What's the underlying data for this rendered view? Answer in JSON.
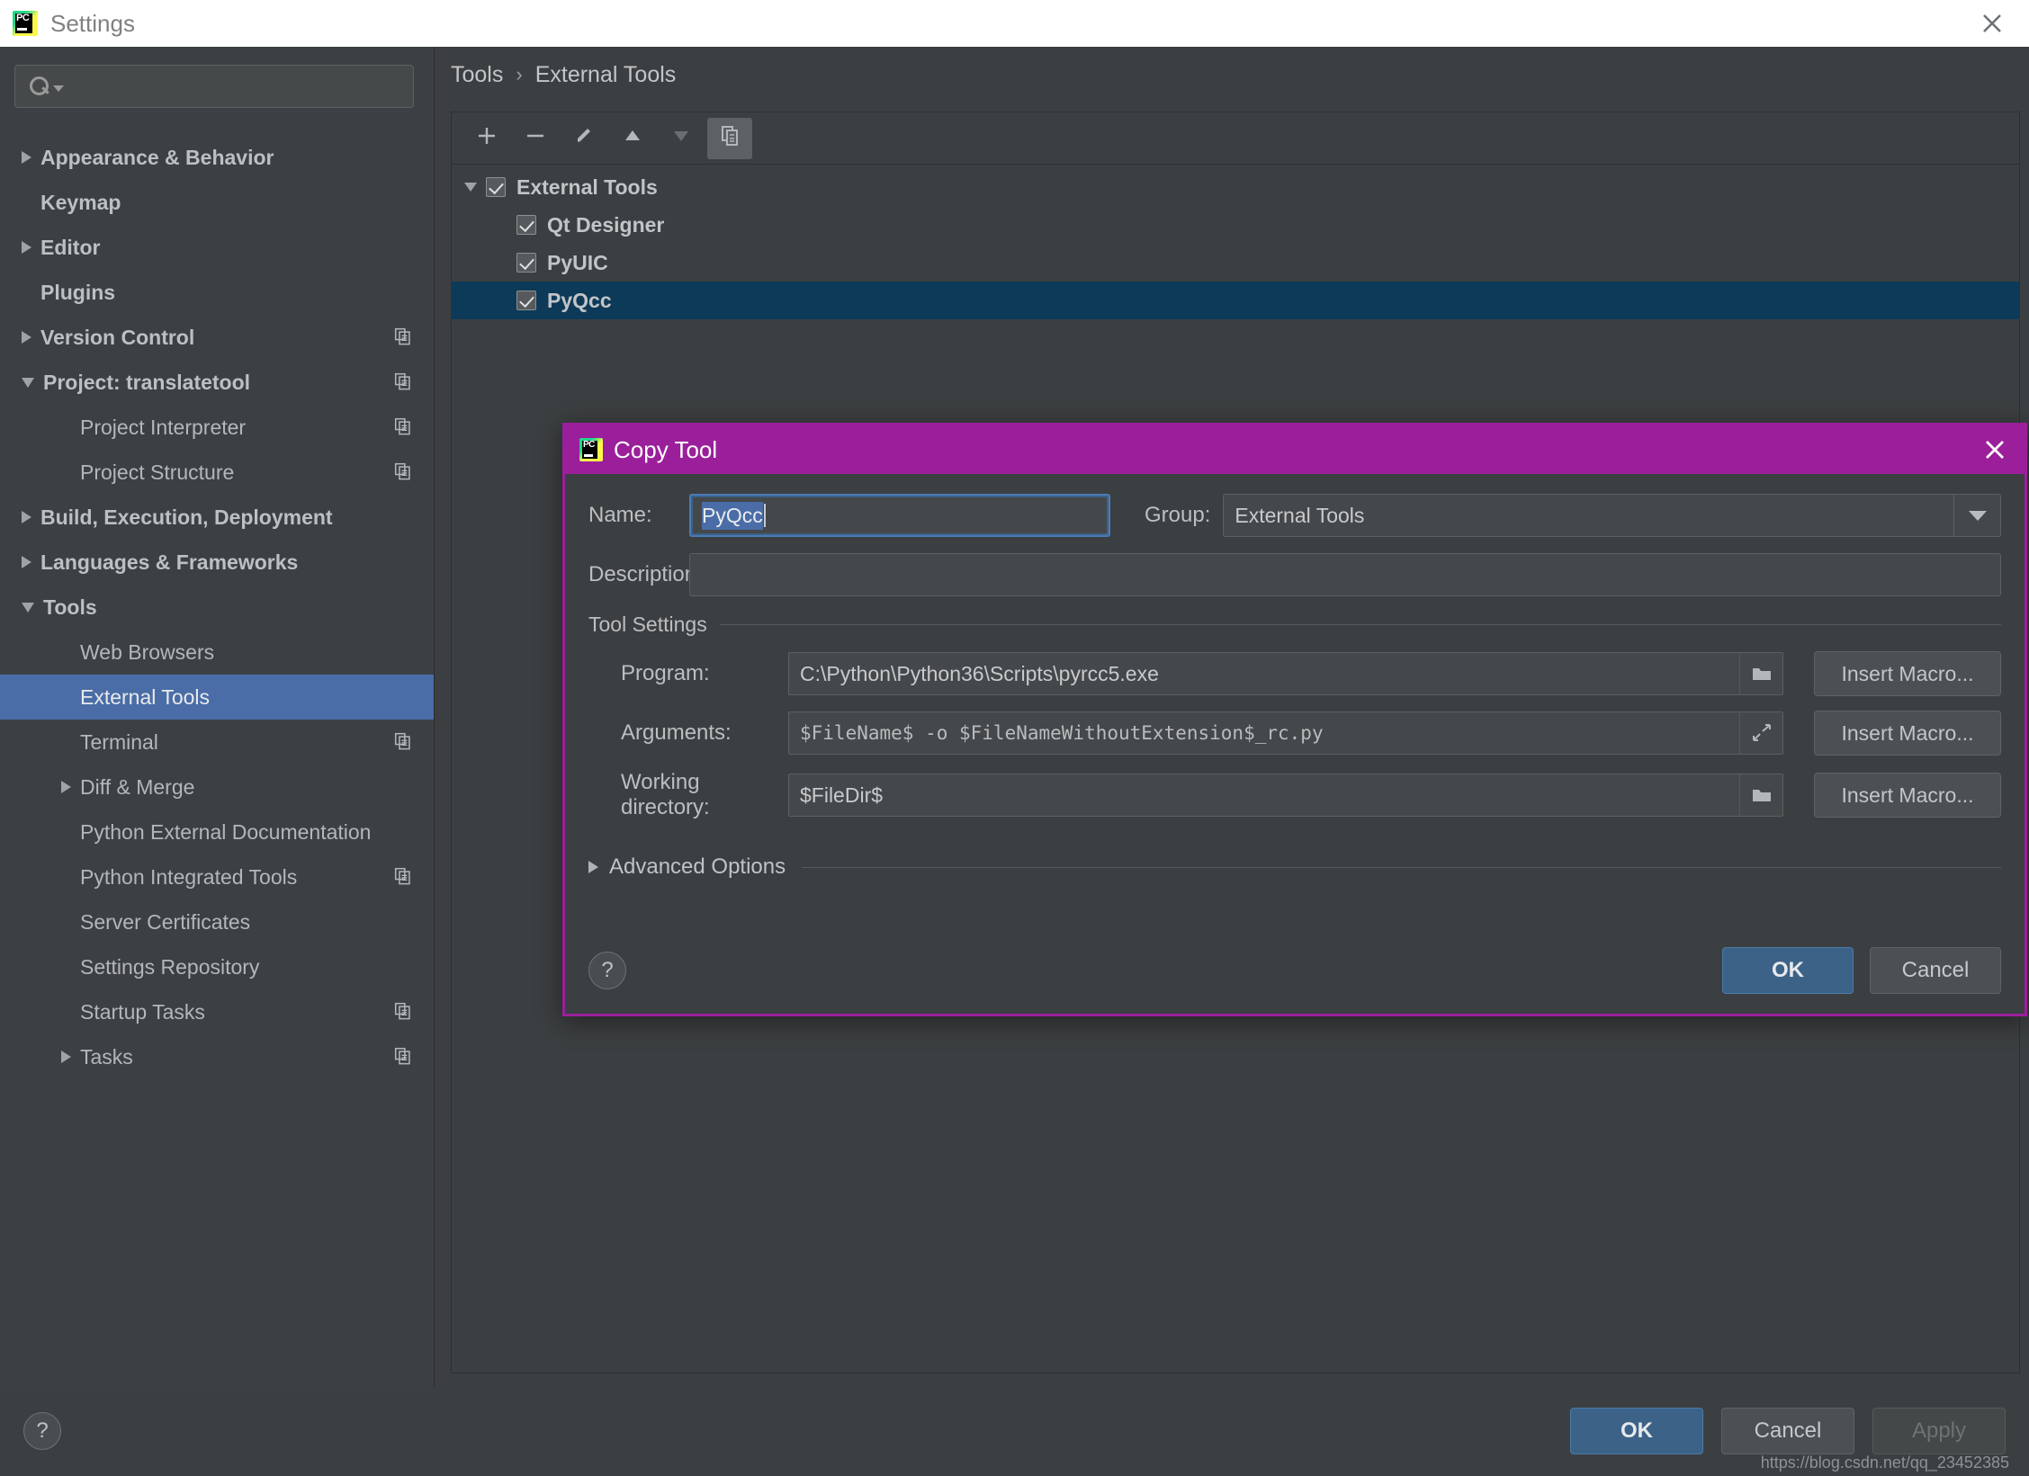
{
  "window": {
    "title": "Settings",
    "close_icon": "close-icon",
    "logo": "pycharm-logo"
  },
  "search": {
    "value": "",
    "placeholder": ""
  },
  "sidebar": {
    "items": [
      {
        "label": "Appearance & Behavior",
        "level": 0,
        "arrow": "right",
        "selected": false,
        "copy": false
      },
      {
        "label": "Keymap",
        "level": 0,
        "arrow": "none",
        "selected": false,
        "copy": false
      },
      {
        "label": "Editor",
        "level": 0,
        "arrow": "right",
        "selected": false,
        "copy": false
      },
      {
        "label": "Plugins",
        "level": 0,
        "arrow": "none",
        "selected": false,
        "copy": false
      },
      {
        "label": "Version Control",
        "level": 0,
        "arrow": "right",
        "selected": false,
        "copy": true
      },
      {
        "label": "Project: translatetool",
        "level": 0,
        "arrow": "down",
        "selected": false,
        "copy": true
      },
      {
        "label": "Project Interpreter",
        "level": 1,
        "arrow": "none",
        "selected": false,
        "copy": true
      },
      {
        "label": "Project Structure",
        "level": 1,
        "arrow": "none",
        "selected": false,
        "copy": true
      },
      {
        "label": "Build, Execution, Deployment",
        "level": 0,
        "arrow": "right",
        "selected": false,
        "copy": false
      },
      {
        "label": "Languages & Frameworks",
        "level": 0,
        "arrow": "right",
        "selected": false,
        "copy": false
      },
      {
        "label": "Tools",
        "level": 0,
        "arrow": "down",
        "selected": false,
        "copy": false
      },
      {
        "label": "Web Browsers",
        "level": 1,
        "arrow": "none",
        "selected": false,
        "copy": false
      },
      {
        "label": "External Tools",
        "level": 1,
        "arrow": "none",
        "selected": true,
        "copy": false
      },
      {
        "label": "Terminal",
        "level": 1,
        "arrow": "none",
        "selected": false,
        "copy": true
      },
      {
        "label": "Diff & Merge",
        "level": 1,
        "arrow": "right",
        "selected": false,
        "copy": false
      },
      {
        "label": "Python External Documentation",
        "level": 1,
        "arrow": "none",
        "selected": false,
        "copy": false
      },
      {
        "label": "Python Integrated Tools",
        "level": 1,
        "arrow": "none",
        "selected": false,
        "copy": true
      },
      {
        "label": "Server Certificates",
        "level": 1,
        "arrow": "none",
        "selected": false,
        "copy": false
      },
      {
        "label": "Settings Repository",
        "level": 1,
        "arrow": "none",
        "selected": false,
        "copy": false
      },
      {
        "label": "Startup Tasks",
        "level": 1,
        "arrow": "none",
        "selected": false,
        "copy": true
      },
      {
        "label": "Tasks",
        "level": 1,
        "arrow": "right",
        "selected": false,
        "copy": true
      }
    ]
  },
  "main": {
    "breadcrumb": {
      "parent": "Tools",
      "separator": "›",
      "current": "External Tools"
    },
    "toolbar": [
      {
        "name": "add-button",
        "icon": "plus-icon",
        "active": false,
        "enabled": true
      },
      {
        "name": "remove-button",
        "icon": "minus-icon",
        "active": false,
        "enabled": true
      },
      {
        "name": "edit-button",
        "icon": "pencil-icon",
        "active": false,
        "enabled": true
      },
      {
        "name": "move-up-button",
        "icon": "arrow-up-icon",
        "active": false,
        "enabled": true
      },
      {
        "name": "move-down-button",
        "icon": "arrow-down-icon",
        "active": false,
        "enabled": false
      },
      {
        "name": "copy-button",
        "icon": "copy-icon",
        "active": true,
        "enabled": true
      }
    ],
    "tree": [
      {
        "label": "External Tools",
        "level": 0,
        "checked": true,
        "expanded": true,
        "selected": false
      },
      {
        "label": "Qt Designer",
        "level": 1,
        "checked": true,
        "expanded": false,
        "selected": false
      },
      {
        "label": "PyUIC",
        "level": 1,
        "checked": true,
        "expanded": false,
        "selected": false
      },
      {
        "label": "PyQcc",
        "level": 1,
        "checked": true,
        "expanded": false,
        "selected": true
      }
    ]
  },
  "bottom_bar": {
    "help_label": "?",
    "ok_label": "OK",
    "cancel_label": "Cancel",
    "apply_label": "Apply",
    "watermark": "https://blog.csdn.net/qq_23452385"
  },
  "dialog": {
    "title": "Copy Tool",
    "close_icon": "close-icon",
    "name_label": "Name:",
    "name_value": "PyQcc",
    "group_label": "Group:",
    "group_value": "External Tools",
    "description_label": "Description:",
    "description_value": "",
    "description_placeholder": "",
    "tool_settings_legend": "Tool Settings",
    "fields": [
      {
        "label": "Program:",
        "value": "C:\\Python\\Python36\\Scripts\\pyrcc5.exe",
        "icon": "folder-icon",
        "mono": false,
        "macro_label": "Insert Macro..."
      },
      {
        "label": "Arguments:",
        "value": "$FileName$ -o $FileNameWithoutExtension$_rc.py",
        "icon": "expand-icon",
        "mono": true,
        "macro_label": "Insert Macro..."
      },
      {
        "label": "Working directory:",
        "value": "$FileDir$",
        "icon": "folder-icon",
        "mono": false,
        "macro_label": "Insert Macro..."
      }
    ],
    "advanced_options_label": "Advanced Options",
    "help_label": "?",
    "ok_label": "OK",
    "cancel_label": "Cancel"
  },
  "colors": {
    "accent_blue": "#4a6da7",
    "dialog_magenta": "#9b1f9b",
    "primary_button": "#3c6288",
    "tree_selection": "#0d3a58",
    "panel_bg": "#3c3f41"
  }
}
